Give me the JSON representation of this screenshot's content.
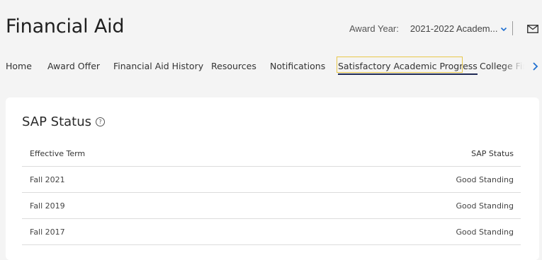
{
  "header": {
    "title": "Financial Aid",
    "award_year_label": "Award Year:",
    "award_year_value": "2021-2022 Academ...",
    "mail_icon": "envelope-icon"
  },
  "tabs": [
    {
      "label": "Home"
    },
    {
      "label": "Award Offer"
    },
    {
      "label": "Financial Aid History"
    },
    {
      "label": "Resources"
    },
    {
      "label": "Notifications"
    },
    {
      "label": "Satisfactory Academic Progress",
      "active": true
    },
    {
      "label": "College Financing Plan"
    }
  ],
  "sap": {
    "title": "SAP Status",
    "help_icon": "question-circle-icon",
    "columns": [
      "Effective Term",
      "SAP Status"
    ],
    "rows": [
      {
        "term": "Fall 2021",
        "status": "Good Standing"
      },
      {
        "term": "Fall 2019",
        "status": "Good Standing"
      },
      {
        "term": "Fall 2017",
        "status": "Good Standing"
      }
    ]
  },
  "colors": {
    "background": "#f4f4f4",
    "active_underline": "#1e2a55",
    "focus_outline": "#e8c84a",
    "accent": "#1f6fd1"
  }
}
